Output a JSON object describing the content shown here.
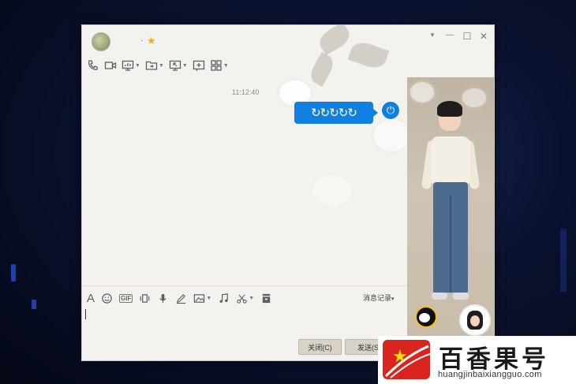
{
  "window": {
    "nickname": ".",
    "vip_star": "★",
    "controls": {
      "menu": "▾",
      "minimize": "—",
      "maximize": "☐",
      "close": "✕"
    }
  },
  "toolbar": {
    "icons": [
      "phone-icon",
      "video-icon",
      "screen-share-icon",
      "file-transfer-icon",
      "remote-desktop-icon",
      "add-app-icon",
      "apps-grid-icon"
    ]
  },
  "chat": {
    "timestamp": "11:12:40",
    "messages": [
      {
        "sender": "me",
        "text": "↻↻↻↻↻"
      }
    ]
  },
  "input_toolbar": {
    "gif_label": "GIF",
    "history_label": "消息记录",
    "history_caret": "▾"
  },
  "buttons": {
    "close_label": "关闭(C)",
    "send_label": "发送(S)"
  },
  "watermark": {
    "title": "百香果号",
    "url": "huangjinbaixiangguo.com"
  },
  "colors": {
    "bubble": "#0f7fe0",
    "window_bg": "#f4f2ee",
    "button_bg": "#d9d3c7",
    "watermark_red": "#d9251d"
  }
}
